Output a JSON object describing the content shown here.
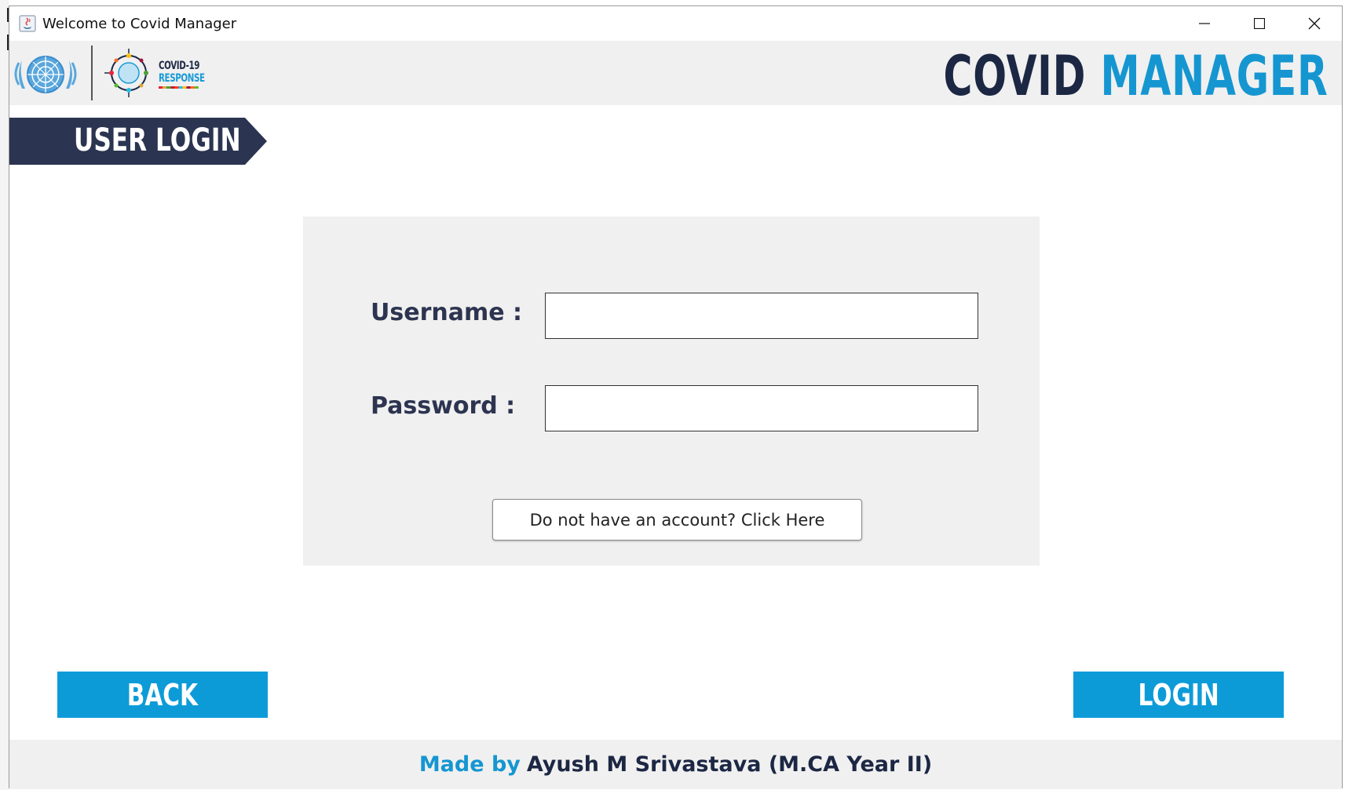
{
  "window": {
    "title": "Welcome to Covid Manager",
    "controls": {
      "minimize": "minimize-icon",
      "maximize": "maximize-icon",
      "close": "close-icon"
    }
  },
  "header": {
    "brand_part1": "COVID",
    "brand_part2": "MANAGER",
    "partner_logo_line1": "COVID-19",
    "partner_logo_line2": "RESPONSE"
  },
  "section": {
    "title": "USER LOGIN"
  },
  "form": {
    "username_label": "Username :",
    "username_value": "",
    "password_label": "Password :",
    "password_value": "",
    "signup_link": "Do not have an account? Click Here"
  },
  "actions": {
    "back_label": "BACK",
    "login_label": "LOGIN"
  },
  "footer": {
    "made_by": "Made by",
    "author": "Ayush M Srivastava (M.CA Year II)"
  },
  "colors": {
    "accent": "#0d9bd8",
    "navy": "#2b3551",
    "panel": "#f0f0f0"
  }
}
